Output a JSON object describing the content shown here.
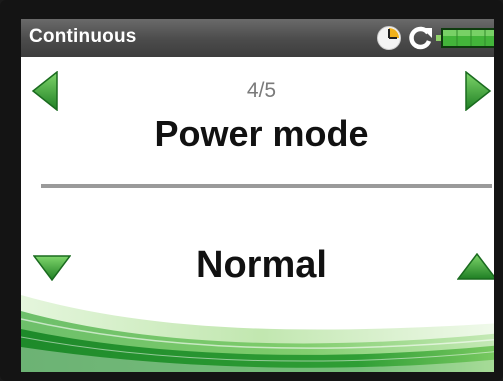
{
  "header": {
    "title": "Continuous",
    "status_icons": [
      "clock-icon",
      "refresh-icon",
      "battery-icon"
    ],
    "battery_level": 1.0
  },
  "navigation": {
    "page_indicator": "4/5",
    "prev_icon": "arrow-left-icon",
    "next_icon": "arrow-right-icon"
  },
  "setting": {
    "title": "Power mode",
    "value": "Normal",
    "decrease_icon": "arrow-down-icon",
    "increase_icon": "arrow-up-icon"
  },
  "colors": {
    "accent_green": "#2e9a2e",
    "titlebar": "#4b4b4b",
    "divider": "#9a9a9a"
  }
}
